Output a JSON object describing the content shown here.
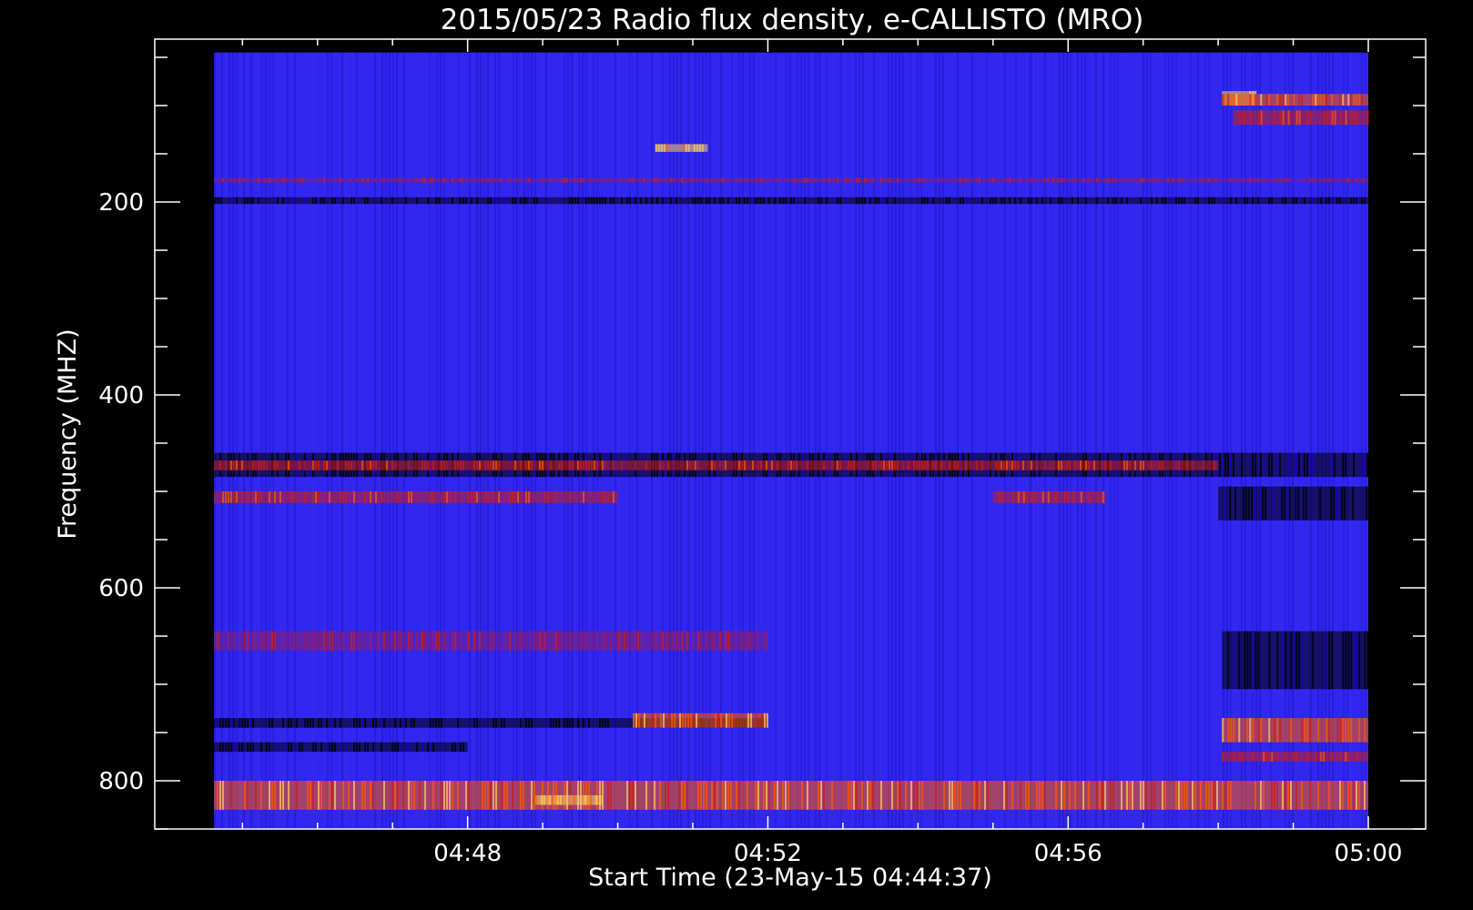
{
  "chart_data": {
    "type": "heatmap",
    "title": "2015/05/23  Radio flux density, e-CALLISTO (MRO)",
    "xlabel": "Start Time (23-May-15 04:44:37)",
    "ylabel": "Frequency (MHZ)",
    "x_ticks": [
      "04:48",
      "04:52",
      "04:56",
      "05:00"
    ],
    "x_tick_values_min": [
      48,
      52,
      56,
      60
    ],
    "y_ticks": [
      "200",
      "400",
      "600",
      "800"
    ],
    "y_tick_values": [
      200,
      400,
      600,
      800
    ],
    "xlim_min": [
      44.62,
      60.0
    ],
    "ylim_mhz": [
      850,
      50
    ],
    "data_range_min": [
      44.62,
      60.0
    ],
    "data_range_mhz": [
      45,
      850
    ],
    "colormap": [
      "#000000",
      "#1a00c8",
      "#3a22ee",
      "#8b1e6e",
      "#c81e1e",
      "#ff5a00",
      "#ffd060"
    ],
    "background_color": "#2f26f0",
    "features": [
      {
        "desc": "bright burst",
        "t": [
          58.05,
          58.5
        ],
        "f": [
          85,
          100
        ],
        "level": 6
      },
      {
        "desc": "emission band",
        "t": [
          58.05,
          60.0
        ],
        "f": [
          88,
          100
        ],
        "level": 5
      },
      {
        "desc": "emission band",
        "t": [
          58.2,
          60.0
        ],
        "f": [
          105,
          120
        ],
        "level": 4
      },
      {
        "desc": "dark band",
        "t": [
          44.62,
          60.0
        ],
        "f": [
          195,
          202
        ],
        "level": 0
      },
      {
        "desc": "red band",
        "t": [
          44.62,
          60.0
        ],
        "f": [
          175,
          180
        ],
        "level": 3
      },
      {
        "desc": "dark band",
        "t": [
          44.62,
          60.0
        ],
        "f": [
          460,
          485
        ],
        "level": 0
      },
      {
        "desc": "red band",
        "t": [
          44.62,
          58.0
        ],
        "f": [
          468,
          478
        ],
        "level": 4
      },
      {
        "desc": "red band",
        "t": [
          44.62,
          50.0
        ],
        "f": [
          500,
          512
        ],
        "level": 4
      },
      {
        "desc": "red band",
        "t": [
          55.0,
          56.5
        ],
        "f": [
          500,
          512
        ],
        "level": 4
      },
      {
        "desc": "dark band",
        "t": [
          58.0,
          60.0
        ],
        "f": [
          495,
          530
        ],
        "level": 0
      },
      {
        "desc": "red band",
        "t": [
          44.62,
          52.0
        ],
        "f": [
          645,
          665
        ],
        "level": 3
      },
      {
        "desc": "dark band",
        "t": [
          58.05,
          60.0
        ],
        "f": [
          645,
          705
        ],
        "level": 0
      },
      {
        "desc": "dark band",
        "t": [
          44.62,
          52.0
        ],
        "f": [
          735,
          745
        ],
        "level": 0
      },
      {
        "desc": "red band",
        "t": [
          50.2,
          52.0
        ],
        "f": [
          730,
          745
        ],
        "level": 5
      },
      {
        "desc": "red band",
        "t": [
          58.05,
          60.0
        ],
        "f": [
          735,
          760
        ],
        "level": 5
      },
      {
        "desc": "red band",
        "t": [
          58.05,
          60.0
        ],
        "f": [
          770,
          780
        ],
        "level": 4
      },
      {
        "desc": "dark band",
        "t": [
          44.62,
          48.0
        ],
        "f": [
          760,
          770
        ],
        "level": 0
      },
      {
        "desc": "bright band",
        "t": [
          44.62,
          60.0
        ],
        "f": [
          800,
          830
        ],
        "level": 5
      },
      {
        "desc": "bright burst",
        "t": [
          48.9,
          49.8
        ],
        "f": [
          815,
          825
        ],
        "level": 6
      },
      {
        "desc": "bright spot",
        "t": [
          50.5,
          51.2
        ],
        "f": [
          140,
          148
        ],
        "level": 6
      }
    ]
  }
}
